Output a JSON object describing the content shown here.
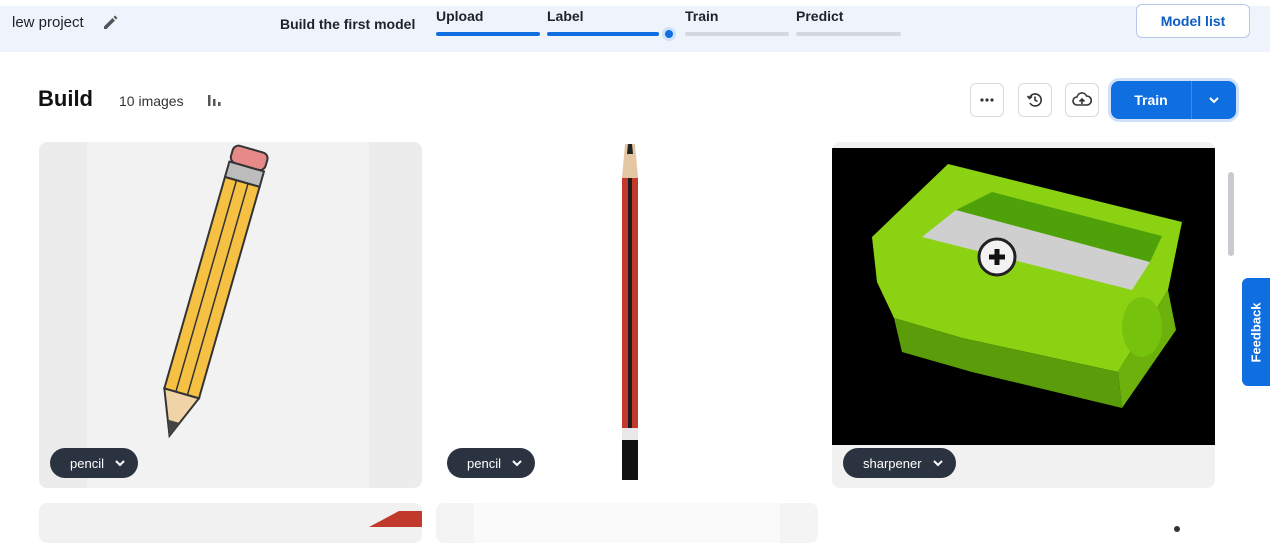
{
  "header": {
    "project_name": "lew project",
    "build_first_model": "Build the first model",
    "steps": [
      {
        "label": "Upload",
        "state": "done"
      },
      {
        "label": "Label",
        "state": "done"
      },
      {
        "label": "Train",
        "state": "current"
      },
      {
        "label": "Predict",
        "state": "todo"
      }
    ],
    "model_list_label": "Model list"
  },
  "toolbar": {
    "title": "Build",
    "image_count": "10 images",
    "stats_icon": "bar-chart-icon",
    "more_icon": "more-horizontal-icon",
    "history_icon": "history-icon",
    "upload_icon": "cloud-upload-icon",
    "train_label": "Train"
  },
  "gallery": {
    "items": [
      {
        "tag": "pencil",
        "image": "cartoon yellow pencil"
      },
      {
        "tag": "pencil",
        "image": "red and black wooden pencil"
      },
      {
        "tag": "sharpener",
        "image": "green pencil sharpener"
      }
    ]
  },
  "feedback_label": "Feedback",
  "colors": {
    "accent": "#0f6fe0",
    "topbar_bg": "#eef3fc",
    "tag_bg": "#2c3340",
    "sharpener_green": "#8bd212"
  }
}
